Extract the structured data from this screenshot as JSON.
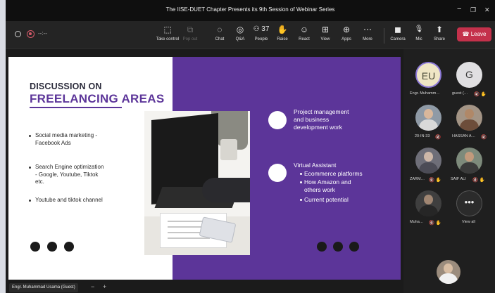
{
  "window": {
    "title": "The IISE-DUET Chapter Presents its 9th Session of Webinar Series",
    "minimize": "−",
    "maximize": "❐",
    "close": "✕"
  },
  "toolbar": {
    "timer": "--:--",
    "buttons": [
      {
        "icon": "share-screen-icon",
        "glyph": "⬚",
        "label": "Take control",
        "disabled": false
      },
      {
        "icon": "pop-out-icon",
        "glyph": "⧉",
        "label": "Pop out",
        "disabled": true
      },
      {
        "icon": "chat-icon",
        "glyph": "◌",
        "label": "Chat",
        "disabled": false
      },
      {
        "icon": "qa-icon",
        "glyph": "◎",
        "label": "Q&A",
        "disabled": false
      },
      {
        "icon": "people-icon",
        "glyph": "⚇ 37",
        "label": "People",
        "disabled": false
      },
      {
        "icon": "raise-hand-icon",
        "glyph": "✋",
        "label": "Raise",
        "disabled": false
      },
      {
        "icon": "react-icon",
        "glyph": "☺",
        "label": "React",
        "disabled": false
      },
      {
        "icon": "view-icon",
        "glyph": "⊞",
        "label": "View",
        "disabled": false
      },
      {
        "icon": "apps-icon",
        "glyph": "⊕",
        "label": "Apps",
        "disabled": false
      },
      {
        "icon": "more-icon",
        "glyph": "⋯",
        "label": "More",
        "disabled": false
      },
      {
        "icon": "camera-icon",
        "glyph": "◼",
        "label": "Camera",
        "disabled": false
      },
      {
        "icon": "mic-icon",
        "glyph": "🎙",
        "label": "Mic",
        "disabled": false
      },
      {
        "icon": "share-icon",
        "glyph": "⬆",
        "label": "Share",
        "disabled": false
      }
    ],
    "leave_icon": "☎",
    "leave_label": "Leave"
  },
  "slide": {
    "title_line1": "DISCUSSION ON",
    "title_line2": "FREELANCING AREAS",
    "left_bullets": [
      "Social media marketing -\nFacebook Ads",
      "Search Engine optimization\n- Google, Youtube, Tiktok\netc.",
      "Youtube and tiktok channel"
    ],
    "right_item1": "Project management\nand business\ndevelopment work",
    "right_item2_title": "Virtual Assistant",
    "right_item2_subs": [
      "Ecommerce platforms",
      "How Amazon and\nothers work",
      "Current potential"
    ],
    "colors": {
      "purple": "#5c3599",
      "white": "#ffffff",
      "dark": "#1a1a1a"
    }
  },
  "self": {
    "name": "Engr. Muhammad Usama (Guest)",
    "minus": "−",
    "plus": "+"
  },
  "participants": [
    {
      "initials": "EU",
      "name": "Engr. Muhamm…",
      "icons": ""
    },
    {
      "initials": "G",
      "name": "guest (…",
      "icons": "🔇 ✋"
    },
    {
      "initials": "",
      "name": "20-IN-33",
      "icons": "🔇"
    },
    {
      "initials": "",
      "name": "HASSAN A…",
      "icons": "🔇"
    },
    {
      "initials": "",
      "name": "ZARM…",
      "icons": "🔇 ✋"
    },
    {
      "initials": "",
      "name": "SAIF ALI",
      "icons": "🔇 ✋"
    },
    {
      "initials": "",
      "name": "Muha…",
      "icons": "🔇 ✋"
    }
  ],
  "view_all": {
    "glyph": "•••",
    "label": "View all"
  }
}
